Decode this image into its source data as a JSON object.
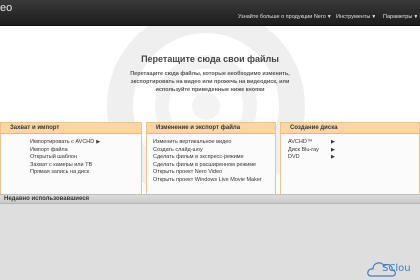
{
  "window": {
    "title": "eo"
  },
  "topbar": {
    "menus": [
      {
        "label": "Узнайте больше о продукции Nero",
        "has_dropdown": true
      },
      {
        "label": "Инструменты",
        "has_dropdown": true
      },
      {
        "label": "Параметры",
        "has_dropdown": true
      }
    ]
  },
  "dropzone": {
    "title": "Перетащите сюда свои файлы",
    "description_lines": [
      "Перетащите сюда файлы, которые необходимо изменить,",
      "экспортировать на видео или прожечь на видеодиск, или",
      "используйте приведенные ниже кнопки"
    ]
  },
  "panels": [
    {
      "title": "Захват и импорт",
      "items": [
        {
          "label": "Импортировать с AVCHD",
          "has_arrow": true
        },
        {
          "label": "Импорт файла",
          "has_arrow": false
        },
        {
          "label": "Открытый шаблон",
          "has_arrow": false
        },
        {
          "label": "Захват с камеры или ТВ",
          "has_arrow": false
        },
        {
          "label": "Прямая запись на диск",
          "has_arrow": false
        }
      ]
    },
    {
      "title": "Изменение и экспорт файла",
      "items": [
        {
          "label": "Изменить вертикальное видео"
        },
        {
          "label": "Создать слайд-шоу"
        },
        {
          "label": "Сделать фильм в экспресс-режиме"
        },
        {
          "label": "Сделать фильм в расширенном режиме"
        },
        {
          "label": "Открыть проект Nero Video"
        },
        {
          "label": "Открыть проект Windows Live Movie Maker"
        }
      ]
    },
    {
      "title": "Создание диска",
      "items": [
        {
          "label": "AVCHD™",
          "has_arrow": true
        },
        {
          "label": "Диск Blu-ray",
          "has_arrow": true
        },
        {
          "label": "DVD",
          "has_arrow": true
        }
      ]
    }
  ],
  "recent": {
    "label": "Недавно использовавшиеся"
  },
  "corner_logo": {
    "text": "SClou"
  },
  "colors": {
    "panel_header": "#fbd79f",
    "panel_border": "#e8c48a",
    "titlebar": "#1c1c1c",
    "logo_blue": "#3d7fc2"
  },
  "icons": {
    "dropdown": "caret-down-icon",
    "submenu": "triangle-right-icon",
    "watermark": "disc-watermark-icon",
    "corner": "cloud-logo-icon"
  }
}
